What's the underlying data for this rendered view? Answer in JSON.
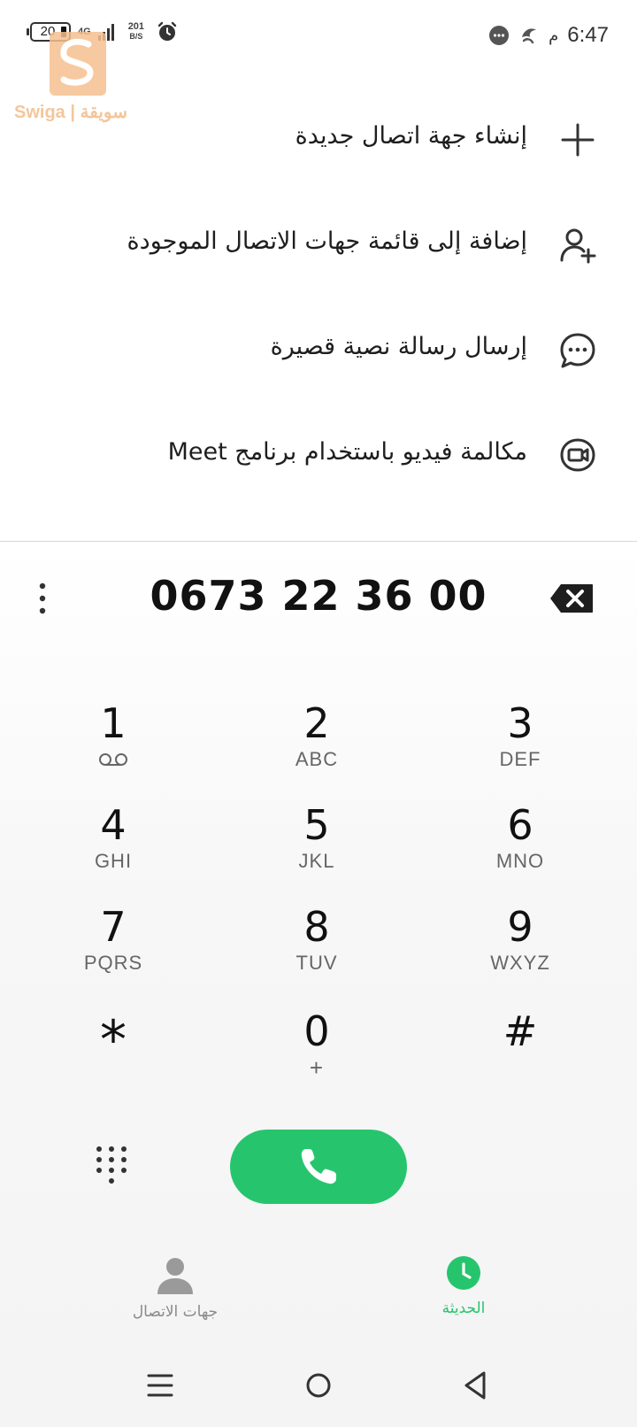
{
  "status_bar": {
    "battery_level": "20",
    "network_type": "4G",
    "net_speed_value": "201",
    "net_speed_unit": "B/S",
    "time": "6:47",
    "ampm": "م"
  },
  "watermark": {
    "text": "Swiga | سويقة"
  },
  "menu": {
    "items": [
      {
        "label": "إنشاء جهة اتصال جديدة",
        "icon": "plus-icon"
      },
      {
        "label": "إضافة إلى قائمة جهات الاتصال الموجودة",
        "icon": "add-person-icon"
      },
      {
        "label": "إرسال رسالة نصية قصيرة",
        "icon": "message-icon"
      },
      {
        "label": "مكالمة فيديو باستخدام برنامج Meet",
        "icon": "video-call-icon"
      }
    ]
  },
  "dialer": {
    "number": "0673 22 36 00",
    "keys": [
      {
        "digit": "1",
        "letters": ""
      },
      {
        "digit": "2",
        "letters": "ABC"
      },
      {
        "digit": "3",
        "letters": "DEF"
      },
      {
        "digit": "4",
        "letters": "GHI"
      },
      {
        "digit": "5",
        "letters": "JKL"
      },
      {
        "digit": "6",
        "letters": "MNO"
      },
      {
        "digit": "7",
        "letters": "PQRS"
      },
      {
        "digit": "8",
        "letters": "TUV"
      },
      {
        "digit": "9",
        "letters": "WXYZ"
      },
      {
        "digit": "*",
        "letters": ""
      },
      {
        "digit": "0",
        "letters": "+"
      },
      {
        "digit": "#",
        "letters": ""
      }
    ]
  },
  "tabs": {
    "contacts": "جهات الاتصال",
    "recent": "الحديثة"
  },
  "colors": {
    "accent_green": "#26c56d"
  }
}
